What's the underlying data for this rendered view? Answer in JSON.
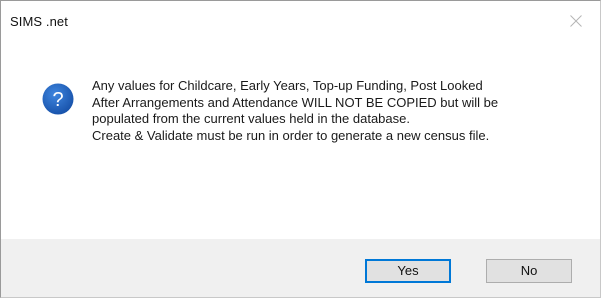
{
  "window": {
    "title": "SIMS .net"
  },
  "icons": {
    "message_icon": "question-icon",
    "close_icon": "close-icon",
    "accent": "#1c5db8"
  },
  "message": {
    "text": "Any values for Childcare, Early Years, Top-up Funding, Post Looked\nAfter Arrangements and Attendance WILL NOT BE COPIED but will be\npopulated from the current values held in the database.\nCreate & Validate must be run in order to generate a new census file."
  },
  "buttons": {
    "yes_label": "Yes",
    "no_label": "No",
    "default": "yes"
  }
}
